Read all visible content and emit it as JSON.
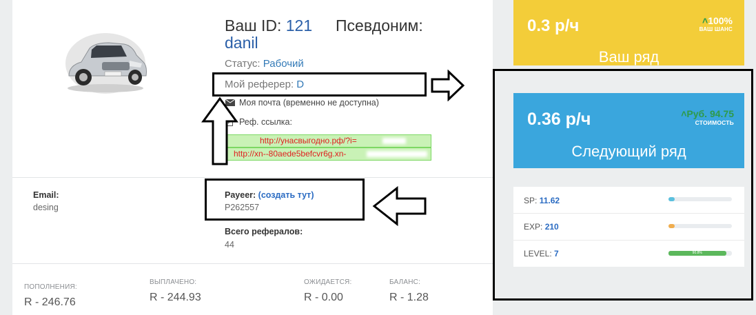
{
  "profile": {
    "id_label": "Ваш ID:",
    "id_value": "121",
    "nickname_label": "Псевдоним:",
    "nickname_value": "danil",
    "status_label": "Статус:",
    "status_value": "Рабочий",
    "referrer_label": "Мой реферер:",
    "referrer_value": "D",
    "email_note": "Моя почта (временно не доступна)",
    "ref_link_label": "Реф. ссылка:",
    "ref_link_1": "http://унасвыгодно.рф/?i=",
    "ref_link_2": "http://xn--80aede5befcvr6g.xn-"
  },
  "account": {
    "email_label": "Email:",
    "email_value": "desing",
    "payeer_label": "Payeer:",
    "payeer_open": "(",
    "payeer_link": "создать тут",
    "payeer_close": ")",
    "payeer_value": "P262557",
    "referrals_label": "Всего рефералов:",
    "referrals_value": "44"
  },
  "finance": [
    {
      "label": "ПОПОЛНЕНИЯ:",
      "value": "R - 246.76"
    },
    {
      "label": "ВЫПЛАЧЕНО:",
      "value": "R - 244.93"
    },
    {
      "label": "ОЖИДАЕТСЯ:",
      "value": "R - 0.00"
    },
    {
      "label": "БАЛАНС:",
      "value": "R - 1.28"
    }
  ],
  "current_row": {
    "rate": "0.3 р/ч",
    "chance": "100%",
    "chance_label": "ВАШ ШАНС",
    "title": "Ваш ряд",
    "color": "#f3cd39"
  },
  "next_row": {
    "rate": "0.36 р/ч",
    "cost": "Руб. 94.75",
    "cost_label": "СТОИМОСТЬ",
    "title": "Следующий ряд",
    "color": "#3aa6dd"
  },
  "stats": [
    {
      "label": "SP:",
      "value": "11.62",
      "fill_fraction": 0.1,
      "color": "#5bc0de"
    },
    {
      "label": "EXP:",
      "value": "210",
      "fill_fraction": 0.1,
      "color": "#f0ad4e"
    },
    {
      "label": "LEVEL:",
      "value": "7",
      "fill_fraction": 0.908,
      "fill_text": "90.8%",
      "color": "#5cb85c"
    }
  ],
  "icons": {
    "car": "car-image",
    "mail": "envelope-icon",
    "edit": "edit-icon",
    "up": "chevron-up-icon",
    "arrows": "annotation-arrow-icon"
  }
}
